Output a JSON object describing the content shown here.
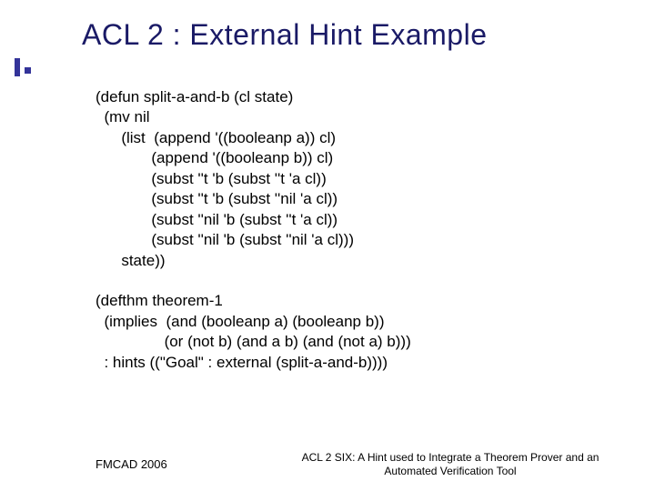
{
  "title": "ACL 2 : External Hint Example",
  "code": "(defun split-a-and-b (cl state)\n  (mv nil\n      (list  (append '((booleanp a)) cl)\n             (append '((booleanp b)) cl)\n             (subst ''t 'b (subst ''t 'a cl))\n             (subst ''t 'b (subst ''nil 'a cl))\n             (subst ''nil 'b (subst ''t 'a cl))\n             (subst ''nil 'b (subst ''nil 'a cl)))\n      state))\n\n(defthm theorem-1\n  (implies  (and (booleanp a) (booleanp b))\n                (or (not b) (and a b) (and (not a) b)))\n  : hints ((\"Goal\" : external (split-a-and-b))))",
  "footer_left": "FMCAD 2006",
  "footer_right": "ACL 2 SIX: A Hint used to Integrate a Theorem Prover and an Automated Verification Tool"
}
